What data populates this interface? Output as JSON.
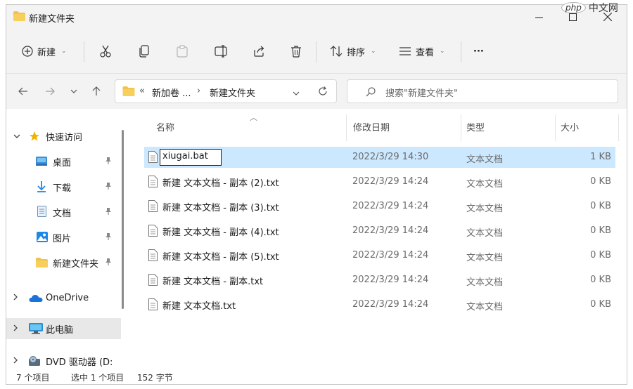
{
  "window": {
    "title": "新建文件夹",
    "controls": [
      "minimize",
      "maximize",
      "close"
    ]
  },
  "watermark": {
    "badge": "php",
    "text": "中文网"
  },
  "toolbar": {
    "new_label": "新建",
    "sort_label": "排序",
    "view_label": "查看",
    "more_label": "···"
  },
  "addressbar": {
    "overflow": "«",
    "crumbs": [
      "新加卷 ...",
      "新建文件夹"
    ],
    "separator": "›"
  },
  "search": {
    "placeholder": "搜索\"新建文件夹\""
  },
  "sidebar": {
    "quick_access": "快速访问",
    "items": [
      {
        "label": "桌面"
      },
      {
        "label": "下载"
      },
      {
        "label": "文档"
      },
      {
        "label": "图片"
      },
      {
        "label": "新建文件夹"
      }
    ],
    "onedrive": "OneDrive",
    "this_pc": "此电脑",
    "dvd": "DVD 驱动器 (D:"
  },
  "filelist": {
    "columns": {
      "name": "名称",
      "date": "修改日期",
      "type": "类型",
      "size": "大小"
    },
    "rows": [
      {
        "name": "xiugai.bat",
        "date": "2022/3/29 14:30",
        "type": "文本文档",
        "size": "1 KB"
      },
      {
        "name": "新建 文本文档 - 副本 (2).txt",
        "date": "2022/3/29 14:24",
        "type": "文本文档",
        "size": "0 KB"
      },
      {
        "name": "新建 文本文档 - 副本 (3).txt",
        "date": "2022/3/29 14:24",
        "type": "文本文档",
        "size": "0 KB"
      },
      {
        "name": "新建 文本文档 - 副本 (4).txt",
        "date": "2022/3/29 14:24",
        "type": "文本文档",
        "size": "0 KB"
      },
      {
        "name": "新建 文本文档 - 副本 (5).txt",
        "date": "2022/3/29 14:24",
        "type": "文本文档",
        "size": "0 KB"
      },
      {
        "name": "新建 文本文档 - 副本.txt",
        "date": "2022/3/29 14:24",
        "type": "文本文档",
        "size": "0 KB"
      },
      {
        "name": "新建 文本文档.txt",
        "date": "2022/3/29 14:24",
        "type": "文本文档",
        "size": "0 KB"
      }
    ]
  },
  "status": {
    "items": "7 个项目",
    "selected": "选中 1 个项目",
    "size": "152 字节"
  },
  "colors": {
    "folder": "#f2c14e",
    "selection": "#cce8ff",
    "chrome": "#f3f3f3",
    "star": "#f0b400",
    "onedrive": "#1a73d9"
  }
}
